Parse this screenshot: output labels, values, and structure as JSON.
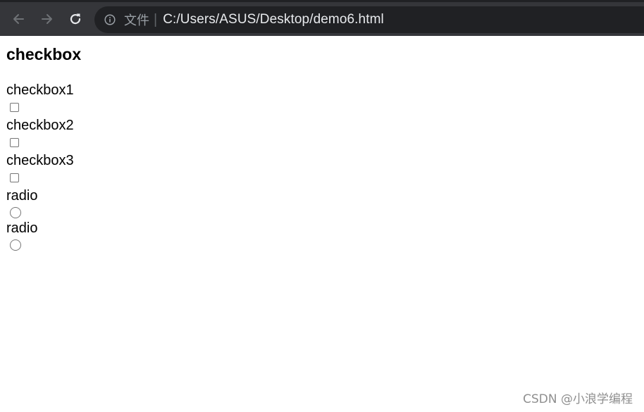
{
  "browser": {
    "scheme_label": "文件",
    "separator": "|",
    "url": "C:/Users/ASUS/Desktop/demo6.html",
    "icons": {
      "back": "arrow-left-icon",
      "forward": "arrow-right-icon",
      "reload": "reload-icon",
      "info": "info-icon"
    }
  },
  "page": {
    "title": "checkbox",
    "fields": [
      {
        "label": "checkbox1",
        "type": "checkbox",
        "checked": false
      },
      {
        "label": "checkbox2",
        "type": "checkbox",
        "checked": false
      },
      {
        "label": "checkbox3",
        "type": "checkbox",
        "checked": false
      },
      {
        "label": "radio",
        "type": "radio",
        "checked": false
      },
      {
        "label": "radio",
        "type": "radio",
        "checked": false
      }
    ]
  },
  "watermark": "CSDN @小浪学编程",
  "colors": {
    "toolbar_bg": "#35363a",
    "omnibox_bg": "#202124",
    "url_text": "#e8eaed"
  }
}
